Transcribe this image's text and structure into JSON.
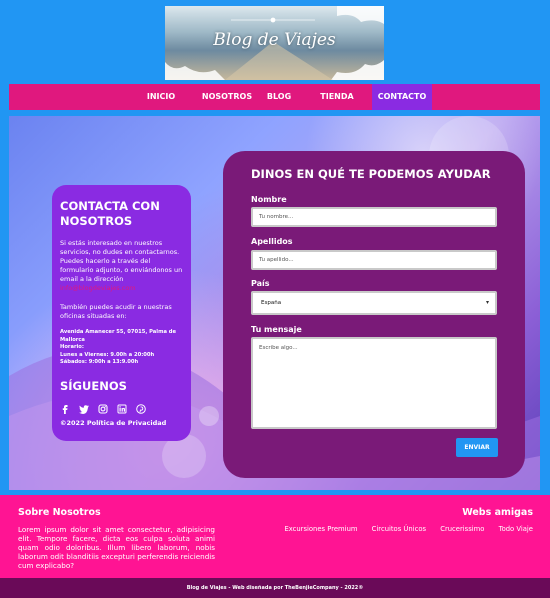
{
  "logo": {
    "text": "Blog de Viajes"
  },
  "nav": {
    "items": [
      {
        "label": "INICIO"
      },
      {
        "label": "NOSOTROS"
      },
      {
        "label": "BLOG"
      },
      {
        "label": "TIENDA"
      },
      {
        "label": "CONTACTO"
      }
    ],
    "active": "CONTACTO"
  },
  "contact": {
    "title": "CONTACTA CON NOSOTROS",
    "intro": "Si estás interesado en nuestros servicios, no dudes en contactarnos.",
    "intro2": "Puedes hacerlo a través del formulario adjunto, o enviándonos un email a la dirección",
    "email": "info@blogdeviajes.com",
    "offices": "También puedes acudir a nuestras oficinas situadas en:",
    "address": "Avenida Amanecer 55, 07015, Palma de Mallorca",
    "hours_label": "Horario:",
    "hours_week": "Lunes a Viernes: 9.00h a 20:00h",
    "hours_sat": "Sábados: 9:00h a 13:9.00h",
    "follow_title": "SÍGUENOS",
    "socials": [
      "facebook-icon",
      "twitter-icon",
      "instagram-icon",
      "linkedin-icon",
      "pinterest-icon"
    ],
    "copyright": "©2022 Política de Privacidad"
  },
  "form": {
    "title": "DINOS EN QUÉ TE PODEMOS AYUDAR",
    "name_label": "Nombre",
    "name_placeholder": "Tu nombre...",
    "surname_label": "Apellidos",
    "surname_placeholder": "Tu apellido...",
    "country_label": "País",
    "country_value": "España",
    "message_label": "Tu mensaje",
    "message_placeholder": "Escribe algo...",
    "send_label": "ENVIAR"
  },
  "footer": {
    "about_title": "Sobre Nosotros",
    "about_text": "Lorem ipsum dolor sit amet consectetur, adipisicing elit. Tempore facere, dicta eos culpa soluta animi quam odio doloribus. Illum libero laborum, nobis laborum odit blanditiis excepturi perferendis reiciendis cum explicabo?",
    "friends_title": "Webs amigas",
    "links": [
      "Excursiones Premium",
      "Circuitos Únicos",
      "Crucerissimo",
      "Todo Viaje"
    ],
    "credits": "Blog de Viajes - Web diseñada por TheBenjieCompany - 2022®"
  },
  "colors": {
    "page_bg": "#2196f3",
    "nav_bg": "#e0187e",
    "nav_active": "#8a2be2",
    "contact_card": "#8a2be2",
    "form_card": "#7a1a78",
    "footer_bg": "#ff1493",
    "bottom_bar": "#6a0a58",
    "button": "#2196f3"
  }
}
